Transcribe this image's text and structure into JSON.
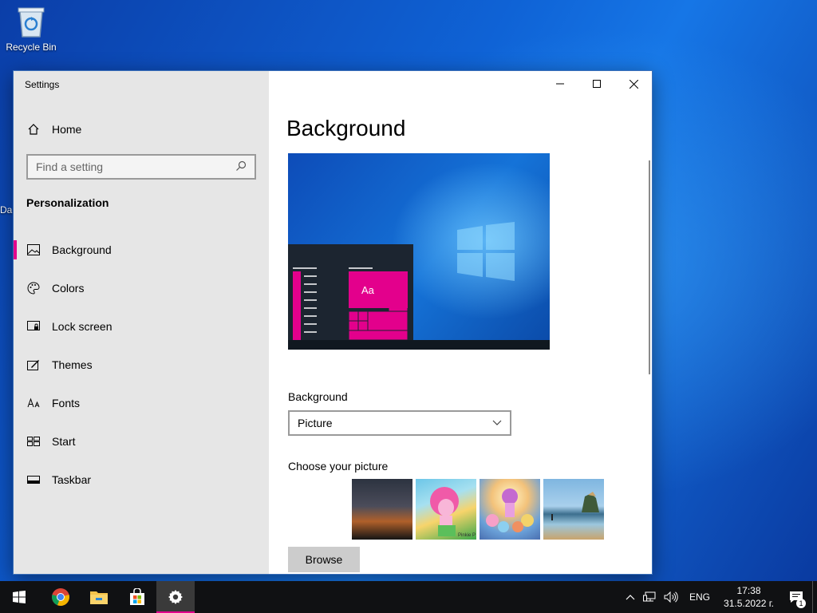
{
  "desktop": {
    "icons": [
      {
        "label": "Recycle Bin",
        "icon": "recycle-bin-icon"
      }
    ],
    "partial_label": "Da"
  },
  "window": {
    "title": "Settings",
    "caption": {
      "minimize": "minimize-icon",
      "maximize": "maximize-icon",
      "close": "close-icon"
    }
  },
  "sidebar": {
    "home_label": "Home",
    "search_placeholder": "Find a setting",
    "section_title": "Personalization",
    "items": [
      {
        "label": "Background",
        "icon": "picture-icon",
        "selected": true
      },
      {
        "label": "Colors",
        "icon": "palette-icon",
        "selected": false
      },
      {
        "label": "Lock screen",
        "icon": "lock-screen-icon",
        "selected": false
      },
      {
        "label": "Themes",
        "icon": "themes-icon",
        "selected": false
      },
      {
        "label": "Fonts",
        "icon": "fonts-icon",
        "selected": false
      },
      {
        "label": "Start",
        "icon": "start-icon",
        "selected": false
      },
      {
        "label": "Taskbar",
        "icon": "taskbar-icon",
        "selected": false
      }
    ]
  },
  "main": {
    "page_title": "Background",
    "preview_tile_text": "Aa",
    "background_label": "Background",
    "background_value": "Picture",
    "choose_label": "Choose your picture",
    "thumbnails": [
      {
        "name": "night-sky"
      },
      {
        "name": "pony-beach",
        "caption": "Pinkie P"
      },
      {
        "name": "pony-group"
      },
      {
        "name": "coastal-rocks"
      }
    ],
    "browse_label": "Browse"
  },
  "taskbar": {
    "apps": [
      {
        "name": "start",
        "icon": "windows-logo-icon"
      },
      {
        "name": "chrome",
        "icon": "chrome-icon"
      },
      {
        "name": "file-explorer",
        "icon": "folder-icon"
      },
      {
        "name": "store",
        "icon": "store-icon"
      },
      {
        "name": "settings",
        "icon": "gear-icon",
        "active": true
      }
    ],
    "tray": {
      "language": "ENG",
      "time": "17:38",
      "date": "31.5.2022 г.",
      "notification_count": "1"
    }
  },
  "colors": {
    "accent": "#e3008c",
    "sidebar_bg": "#e6e6e6",
    "taskbar_bg": "#101113"
  }
}
